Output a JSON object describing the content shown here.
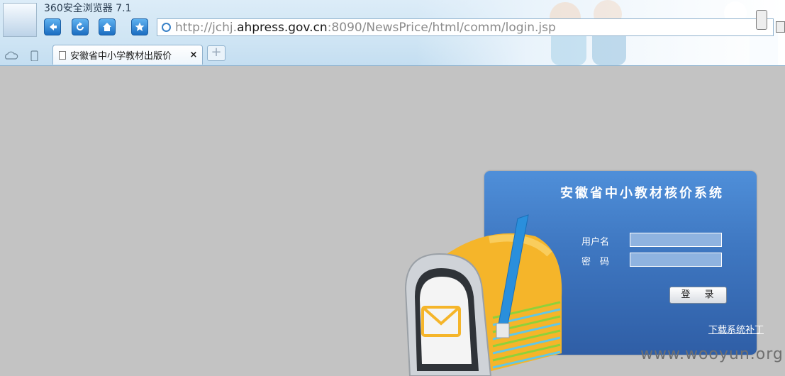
{
  "browser": {
    "title": "360安全浏览器 7.1",
    "address": {
      "prefix": "http://jchj.",
      "domain": "ahpress.gov.cn",
      "suffix": ":8090/NewsPrice/html/comm/login.jsp"
    },
    "tab": {
      "label": "安徽省中小学教材出版价",
      "close": "×"
    },
    "new_tab_symbol": "+"
  },
  "login": {
    "system_title": "安徽省中小教材核价系统",
    "username_label": "用户名",
    "password_label": "密　码",
    "username_value": "",
    "password_value": "",
    "submit_label": "登 录",
    "patch_link": "下载系统补丁"
  },
  "watermark": "www.wooyun.org",
  "colors": {
    "page_bg": "#c3c3c3",
    "panel_top": "#4f8fd9",
    "panel_bottom": "#2f5ea6",
    "mailbox_yellow": "#f5b52a"
  }
}
